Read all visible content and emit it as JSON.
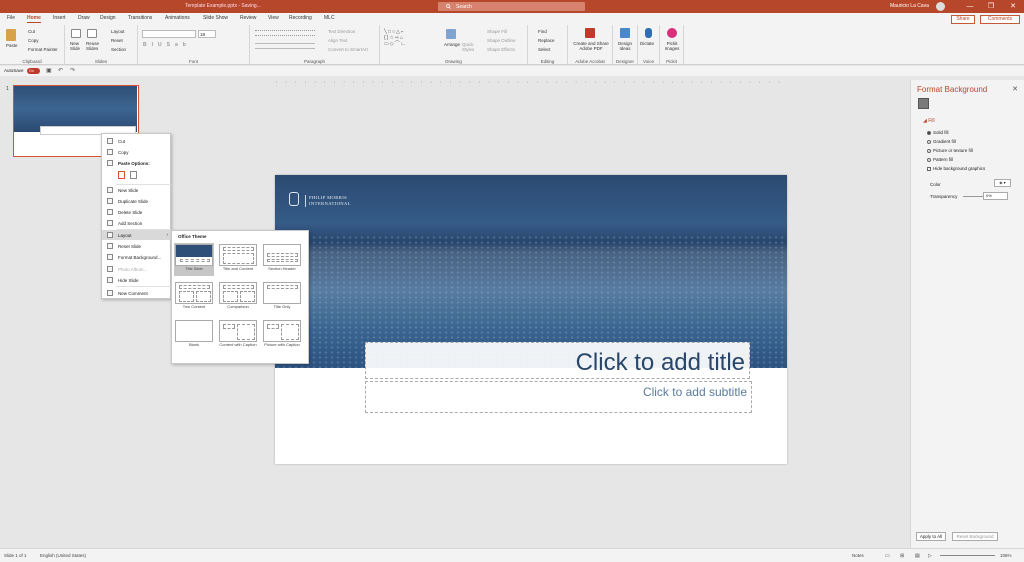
{
  "titlebar": {
    "doc_title": "Template Example.pptx  -  Saving...",
    "search_placeholder": "Search",
    "user_name": "Mauricio La Cava",
    "minimize": "—",
    "restore": "❐",
    "close": "✕"
  },
  "tabs": [
    "File",
    "Home",
    "Insert",
    "Draw",
    "Design",
    "Transitions",
    "Animations",
    "Slide Show",
    "Review",
    "View",
    "Recording",
    "MLC"
  ],
  "share_label": "Share",
  "comments_label": "Comments",
  "ribbon": {
    "clipboard": {
      "label": "Clipboard",
      "paste": "Paste",
      "cut": "Cut",
      "copy": "Copy",
      "format_painter": "Format Painter"
    },
    "slides": {
      "label": "Slides",
      "new_slide": "New Slide",
      "reuse_slides": "Reuse Slides",
      "layout": "Layout",
      "reset": "Reset",
      "section": "Section"
    },
    "font": {
      "label": "Font",
      "size": "18"
    },
    "paragraph": {
      "label": "Paragraph",
      "text_direction": "Text Direction",
      "align_text": "Align Text",
      "convert_smartart": "Convert to SmartArt"
    },
    "drawing": {
      "label": "Drawing",
      "arrange": "Arrange",
      "quick_styles": "Quick Styles",
      "shape_fill": "Shape Fill",
      "shape_outline": "Shape Outline",
      "shape_effects": "Shape Effects"
    },
    "editing": {
      "label": "Editing",
      "find": "Find",
      "replace": "Replace",
      "select": "Select"
    },
    "adobe": {
      "label": "Adobe Acrobat",
      "create_share": "Create and Share Adobe PDF"
    },
    "designer": {
      "label": "Designer",
      "design_ideas": "Design Ideas"
    },
    "voice": {
      "label": "Voice",
      "dictate": "Dictate"
    },
    "pickit": {
      "label": "Pickit",
      "pickit_images": "Pickit Images"
    }
  },
  "qat": {
    "autosave": "AutoSave",
    "toggle": "On"
  },
  "thumb_number": "1",
  "context_menu": {
    "cut": "Cut",
    "copy": "Copy",
    "paste_options": "Paste Options:",
    "new_slide": "New Slide",
    "duplicate_slide": "Duplicate Slide",
    "delete_slide": "Delete Slide",
    "add_section": "Add Section",
    "layout": "Layout",
    "reset_slide": "Reset Slide",
    "format_background": "Format Background...",
    "photo_album": "Photo Album...",
    "hide_slide": "Hide Slide",
    "new_comment": "New Comment"
  },
  "layout_menu": {
    "header": "Office Theme",
    "items": [
      "Title Slide",
      "Title and Content",
      "Section Header",
      "Two Content",
      "Comparison",
      "Title Only",
      "Blank",
      "Content with Caption",
      "Picture with Caption"
    ]
  },
  "slide": {
    "brand_line1": "PHILIP MORRIS",
    "brand_line2": "INTERNATIONAL",
    "title_placeholder": "Click to add title",
    "subtitle_placeholder": "Click to add subtitle"
  },
  "format_pane": {
    "title": "Format Background",
    "fill": "Fill",
    "options": [
      "Solid fill",
      "Gradient fill",
      "Picture or texture fill",
      "Pattern fill"
    ],
    "hide_bg": "Hide background graphics",
    "color": "Color",
    "transparency": "Transparency",
    "transparency_value": "0%",
    "apply_all": "Apply to All",
    "reset_bg": "Reset Background"
  },
  "status": {
    "slide_of": "Slide 1 of 1",
    "language": "English (United States)",
    "notes": "Notes",
    "zoom": "106%"
  },
  "colors": {
    "accent": "#b7472a",
    "slide_blue": "#2b4a72",
    "title_text": "#27466a"
  }
}
